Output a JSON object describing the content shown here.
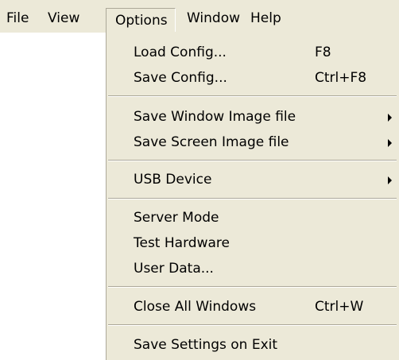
{
  "menubar": {
    "items": [
      {
        "label": "File"
      },
      {
        "label": "View"
      },
      {
        "label": "Options"
      },
      {
        "label": "Window"
      },
      {
        "label": "Help"
      }
    ]
  },
  "options_menu": {
    "groups": [
      [
        {
          "label": "Load Config...",
          "shortcut": "F8"
        },
        {
          "label": "Save Config...",
          "shortcut": "Ctrl+F8"
        }
      ],
      [
        {
          "label": "Save Window Image file",
          "submenu_icon": "chevron-right-icon"
        },
        {
          "label": "Save Screen Image file",
          "submenu_icon": "chevron-right-icon"
        }
      ],
      [
        {
          "label": "USB Device",
          "submenu_icon": "chevron-right-icon"
        }
      ],
      [
        {
          "label": "Server Mode"
        },
        {
          "label": "Test Hardware"
        },
        {
          "label": "User Data..."
        }
      ],
      [
        {
          "label": "Close All Windows",
          "shortcut": "Ctrl+W"
        }
      ],
      [
        {
          "label": "Save Settings on Exit"
        }
      ]
    ]
  }
}
